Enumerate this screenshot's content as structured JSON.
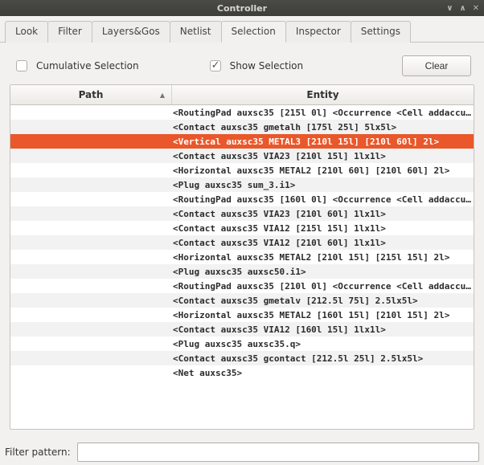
{
  "window": {
    "title": "Controller"
  },
  "tabs": {
    "items": [
      {
        "label": "Look"
      },
      {
        "label": "Filter"
      },
      {
        "label": "Layers&Gos"
      },
      {
        "label": "Netlist"
      },
      {
        "label": "Selection"
      },
      {
        "label": "Inspector"
      },
      {
        "label": "Settings"
      }
    ],
    "active_index": 4
  },
  "toolbar": {
    "cumulative_label": "Cumulative Selection",
    "cumulative_checked": false,
    "show_label": "Show Selection",
    "show_checked": true,
    "clear_label": "Clear"
  },
  "table": {
    "headers": {
      "path": "Path",
      "entity": "Entity"
    },
    "sort": {
      "column": "path",
      "direction": "asc"
    },
    "selected_index": 2,
    "rows": [
      {
        "path": "",
        "entity": "<RoutingPad auxsc35 [215l 0l] <Occurrence <Cell addaccu…"
      },
      {
        "path": "",
        "entity": "<Contact auxsc35 gmetalh [175l 25l] 5lx5l>"
      },
      {
        "path": "",
        "entity": "<Vertical auxsc35 METAL3 [210l 15l] [210l 60l] 2l>"
      },
      {
        "path": "",
        "entity": "<Contact auxsc35 VIA23 [210l 15l] 1lx1l>"
      },
      {
        "path": "",
        "entity": "<Horizontal auxsc35 METAL2 [210l 60l] [210l 60l] 2l>"
      },
      {
        "path": "",
        "entity": "<Plug auxsc35 sum_3.i1>"
      },
      {
        "path": "",
        "entity": "<RoutingPad auxsc35 [160l 0l] <Occurrence <Cell addaccu…"
      },
      {
        "path": "",
        "entity": "<Contact auxsc35 VIA23 [210l 60l] 1lx1l>"
      },
      {
        "path": "",
        "entity": "<Contact auxsc35 VIA12 [215l 15l] 1lx1l>"
      },
      {
        "path": "",
        "entity": "<Contact auxsc35 VIA12 [210l 60l] 1lx1l>"
      },
      {
        "path": "",
        "entity": "<Horizontal auxsc35 METAL2 [210l 15l] [215l 15l] 2l>"
      },
      {
        "path": "",
        "entity": "<Plug auxsc35 auxsc50.i1>"
      },
      {
        "path": "",
        "entity": "<RoutingPad auxsc35 [210l 0l] <Occurrence <Cell addaccu…"
      },
      {
        "path": "",
        "entity": "<Contact auxsc35 gmetalv [212.5l 75l] 2.5lx5l>"
      },
      {
        "path": "",
        "entity": "<Horizontal auxsc35 METAL2 [160l 15l] [210l 15l] 2l>"
      },
      {
        "path": "",
        "entity": "<Contact auxsc35 VIA12 [160l 15l] 1lx1l>"
      },
      {
        "path": "",
        "entity": "<Plug auxsc35 auxsc35.q>"
      },
      {
        "path": "",
        "entity": "<Contact auxsc35 gcontact [212.5l 25l] 2.5lx5l>"
      },
      {
        "path": "",
        "entity": "<Net auxsc35>"
      }
    ]
  },
  "filter": {
    "label": "Filter pattern:",
    "value": ""
  }
}
